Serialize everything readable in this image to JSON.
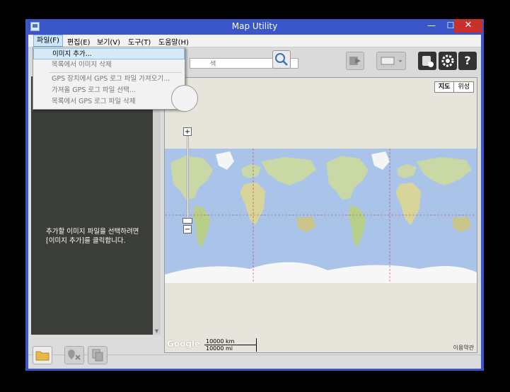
{
  "window": {
    "title": "Map Utility",
    "minimize": "—",
    "maximize": "☐",
    "close": "✕"
  },
  "menu": {
    "items": [
      {
        "label": "파일(F)"
      },
      {
        "label": "편집(E)"
      },
      {
        "label": "보기(V)"
      },
      {
        "label": "도구(T)"
      },
      {
        "label": "도움말(H)"
      }
    ],
    "file_dropdown": [
      "이미지 추가...",
      "목록에서 이미지 삭제",
      "GPS 장치에서 GPS 로그 파일 가져오기...",
      "가져올 GPS 로그 파일 선택...",
      "목록에서 GPS 로그 파일 삭제"
    ]
  },
  "search": {
    "placeholder": "색"
  },
  "left_pane": {
    "hint_line1": "추가할 이미지 파일을 선택하려면",
    "hint_line2": "[이미지 추가]를 클릭합니다."
  },
  "map": {
    "type_map": "지도",
    "type_satellite": "위성",
    "scale_km": "10000 km",
    "scale_mi": "10000 mi",
    "brand": "Google",
    "terms": "이용약관"
  },
  "icons": {
    "search": "magnifier-icon",
    "export": "export-icon",
    "display": "display-icon",
    "gps_device": "gps-device-icon",
    "settings": "gear-icon",
    "help": "help-icon",
    "folder": "folder-icon",
    "remove_location": "remove-location-icon",
    "copy": "copy-icon"
  },
  "colors": {
    "titlebar": "#3a55c8",
    "close": "#c7302b",
    "left_pane": "#3b3d38",
    "ocean": "#a9c4e8",
    "land": "#c9d8a4"
  }
}
